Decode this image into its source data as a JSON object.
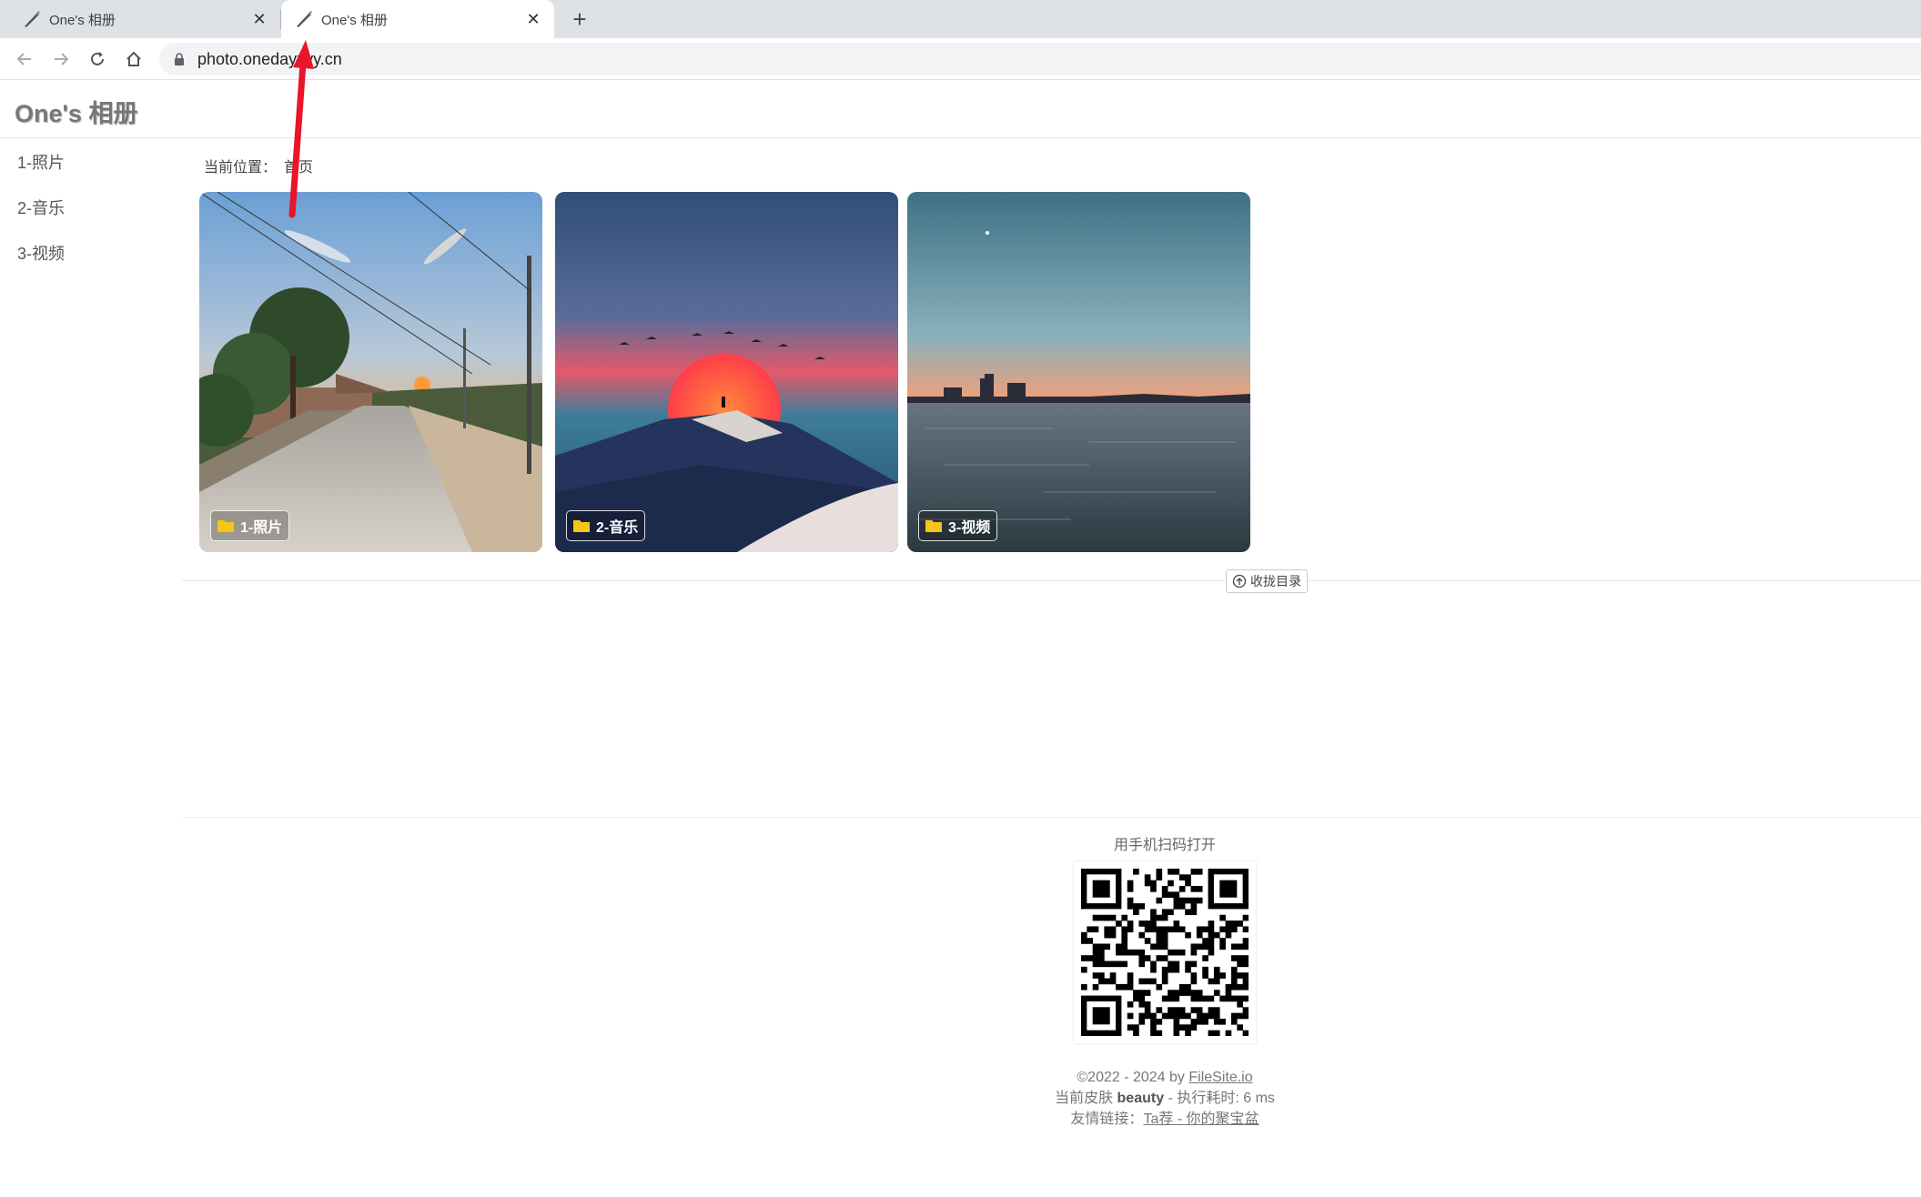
{
  "browser": {
    "tabs": [
      {
        "title": "One's 相册",
        "active": false
      },
      {
        "title": "One's 相册",
        "active": true
      }
    ],
    "url": "photo.onedayxyy.cn"
  },
  "site": {
    "title": "One's 相册",
    "sidebar": [
      "1-照片",
      "2-音乐",
      "3-视频"
    ],
    "breadcrumb_label": "当前位置：",
    "breadcrumb_home": "首页",
    "folders": [
      {
        "label": "1-照片",
        "scene": "country-road-sunset"
      },
      {
        "label": "2-音乐",
        "scene": "desert-dune-sunset"
      },
      {
        "label": "3-视频",
        "scene": "lake-skyline-dusk"
      }
    ],
    "collapse_label": "收拢目录"
  },
  "footer": {
    "qr_caption": "用手机扫码打开",
    "copyright_prefix": "©2022 - 2024 by ",
    "copyright_link": "FileSite.io",
    "skin_prefix": "当前皮肤 ",
    "skin_name": "beauty",
    "exec_time": " - 执行耗时: 6 ms",
    "links_prefix": "友情链接：",
    "links_link": "Ta荐 - 你的聚宝盆"
  },
  "colors": {
    "annotation_arrow": "#e8152b",
    "folder_icon": "#f5c518"
  }
}
